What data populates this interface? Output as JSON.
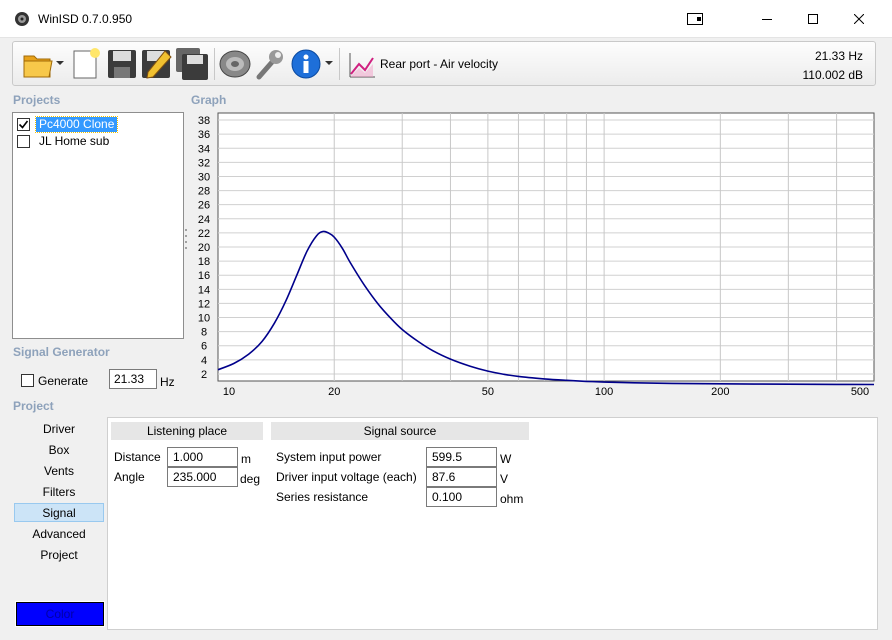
{
  "window": {
    "title": "WinISD 0.7.0.950"
  },
  "toolbar": {
    "graph_mode": "Rear port - Air velocity",
    "readout_hz": "21.33 Hz",
    "readout_db": "110.002 dB"
  },
  "sections": {
    "projects": "Projects",
    "signal_generator": "Signal Generator",
    "project": "Project",
    "graph": "Graph"
  },
  "projects": [
    {
      "name": "Pc4000 Clone",
      "checked": true,
      "selected": true
    },
    {
      "name": "JL Home sub",
      "checked": false,
      "selected": false
    }
  ],
  "generator": {
    "label": "Generate",
    "checked": false,
    "frequency": "21.33",
    "unit": "Hz"
  },
  "tabs": [
    "Driver",
    "Box",
    "Vents",
    "Filters",
    "Signal",
    "Advanced",
    "Project"
  ],
  "active_tab": "Signal",
  "color_button": "Color",
  "colors": {
    "curve": "#00008b",
    "selection": "#3399ff",
    "section_label": "#8ea2bb",
    "color_swatch": "#0000ff"
  },
  "listening_place": {
    "header": "Listening place",
    "distance": {
      "label": "Distance",
      "value": "1.000",
      "unit": "m"
    },
    "angle": {
      "label": "Angle",
      "value": "235.000",
      "unit": "deg"
    }
  },
  "signal_source": {
    "header": "Signal source",
    "power": {
      "label": "System input power",
      "value": "599.5",
      "unit": "W"
    },
    "voltage": {
      "label": "Driver input voltage (each)",
      "value": "87.6",
      "unit": "V"
    },
    "resistance": {
      "label": "Series resistance",
      "value": "0.100",
      "unit": "ohm"
    }
  },
  "chart_data": {
    "type": "line",
    "x_scale": "log",
    "xlim": [
      10,
      500
    ],
    "ylim": [
      1,
      39
    ],
    "x_ticks": [
      10,
      20,
      50,
      100,
      200,
      500
    ],
    "y_ticks": [
      2,
      4,
      6,
      8,
      10,
      12,
      14,
      16,
      18,
      20,
      22,
      24,
      26,
      28,
      30,
      32,
      34,
      36,
      38
    ],
    "grid": true,
    "series": [
      {
        "x": [
          10,
          11,
          12,
          13,
          14,
          15,
          16,
          17,
          18,
          18.7,
          19.3,
          20,
          21,
          22,
          24,
          26,
          28,
          30,
          33,
          36,
          40,
          45,
          50,
          55,
          60,
          70,
          80,
          90,
          100,
          120,
          150,
          200,
          300,
          400,
          500
        ],
        "y": [
          2.6,
          3.5,
          4.8,
          6.6,
          9.2,
          12.4,
          16.0,
          19.4,
          21.6,
          22.2,
          22.0,
          21.4,
          19.8,
          17.8,
          14.5,
          11.9,
          9.9,
          8.3,
          6.6,
          5.3,
          4.1,
          3.1,
          2.4,
          1.95,
          1.65,
          1.3,
          1.1,
          0.95,
          0.85,
          0.75,
          0.66,
          0.6,
          0.55,
          0.52,
          0.5
        ]
      }
    ]
  }
}
